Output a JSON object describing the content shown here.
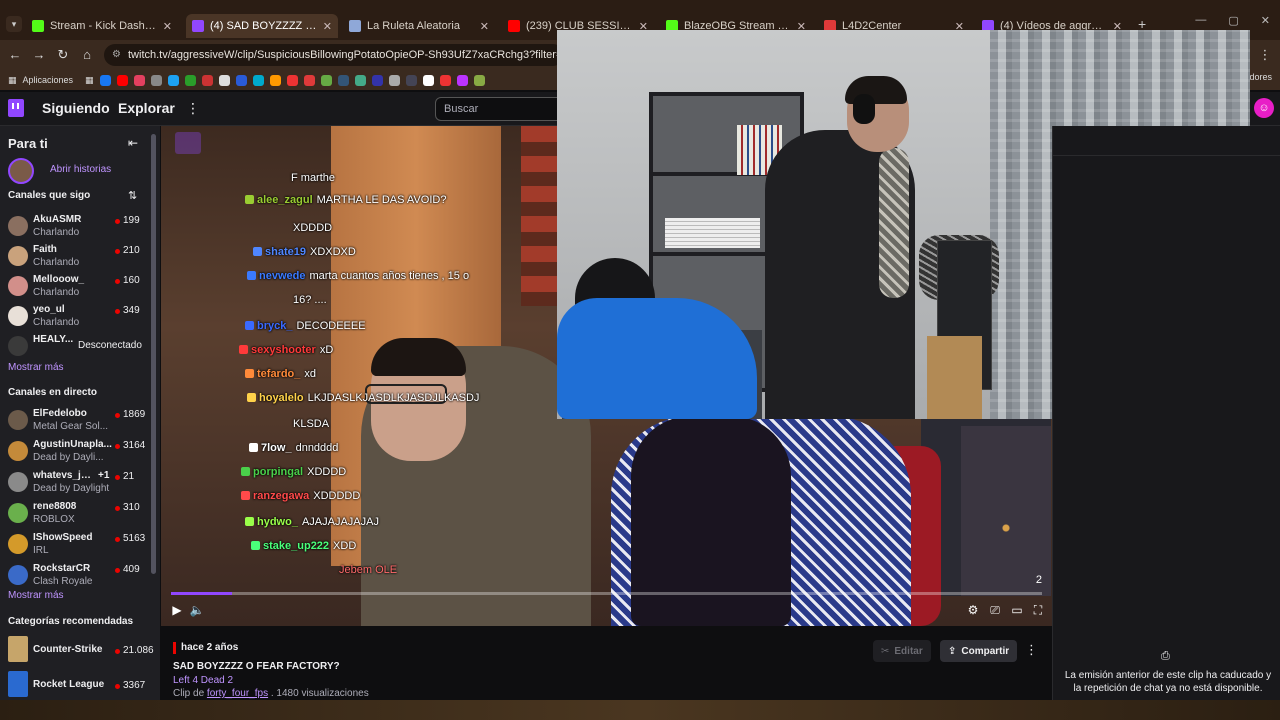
{
  "browser": {
    "tabs": [
      {
        "label": "Stream - Kick Dashboard",
        "color": "#53fc18",
        "active": false
      },
      {
        "label": "(4) SAD BOYZZZZ O FEAR FACTO",
        "color": "#9147ff",
        "active": true
      },
      {
        "label": "La Ruleta Aleatoria",
        "color": "#8fa8d8",
        "active": false
      },
      {
        "label": "(239) CLUB SESSION #01 | DJ S",
        "color": "#ff0000",
        "active": false
      },
      {
        "label": "BlazeOBG Stream - Watch Live",
        "color": "#53fc18",
        "active": false
      },
      {
        "label": "L4D2Center",
        "color": "#e03a3a",
        "active": false
      },
      {
        "label": "(4) Vídeos de aggressiveW - Tw",
        "color": "#9147ff",
        "active": false
      }
    ],
    "url": "twitch.tv/aggressiveW/clip/SuspiciousBillowingPotatoOpieOP-Sh93UfZ7xaCRchg3?filter=clips&range=all",
    "bookmarks_label": "Aplicaciones",
    "bookmarks_right": "adores"
  },
  "twitch_nav": {
    "following": "Siguiendo",
    "browse": "Explorar",
    "search_placeholder": "Buscar"
  },
  "sidebar": {
    "for_you": "Para ti",
    "stories": "Abrir historias",
    "followed_title": "Canales que sigo",
    "followed": [
      {
        "name": "AkuASMR",
        "category": "Charlando",
        "viewers": "199",
        "color": "#8a6f60"
      },
      {
        "name": "Faith",
        "category": "Charlando",
        "viewers": "210",
        "color": "#c9a27c"
      },
      {
        "name": "Mellooow_",
        "category": "Charlando",
        "viewers": "160",
        "color": "#d28f8a"
      },
      {
        "name": "yeo_ul",
        "category": "Charlando",
        "viewers": "349",
        "color": "#e8e0d8"
      }
    ],
    "offline": {
      "name": "HEALY...",
      "status": "Desconectado",
      "color": "#3a3a3a"
    },
    "show_more": "Mostrar más",
    "live_title": "Canales en directo",
    "live": [
      {
        "name": "ElFedelobo",
        "category": "Metal Gear Sol...",
        "viewers": "1869",
        "color": "#6b5a4a"
      },
      {
        "name": "AgustinUnapla...",
        "category": "Dead by Dayli...",
        "viewers": "3164",
        "color": "#c48a3a"
      },
      {
        "name": "whatevs_jan...",
        "extra": "+1",
        "category": "Dead by Daylight",
        "viewers": "21",
        "color": "#8a8a8a"
      },
      {
        "name": "rene8808",
        "category": "ROBLOX",
        "viewers": "310",
        "color": "#6ab04c"
      },
      {
        "name": "IShowSpeed",
        "category": "IRL",
        "viewers": "5163",
        "color": "#d49a2a"
      },
      {
        "name": "RockstarCR",
        "category": "Clash Royale",
        "viewers": "409",
        "color": "#3a6ac8"
      }
    ],
    "show_more_2": "Mostrar más",
    "recommended_title": "Categorías recomendadas",
    "recommended": [
      {
        "name": "Counter-Strike",
        "viewers": "21.086",
        "color": "#c6a56a"
      },
      {
        "name": "Rocket League",
        "viewers": "3367",
        "color": "#2a6ad0"
      }
    ]
  },
  "video": {
    "chat": [
      {
        "user": "",
        "text": "F marthe",
        "color": "#ffffff"
      },
      {
        "user": "alee_zagul",
        "text": "MARTHA LE DAS AVOID?",
        "color": "#9acd32"
      },
      {
        "user": "",
        "text": "XDDDD",
        "color": "#ffffff"
      },
      {
        "user": "shate19",
        "text": "XDXDXD",
        "color": "#4f86ff"
      },
      {
        "user": "nevwede",
        "text": "marta cuantos años tienes , 15 o",
        "color": "#3a7aff"
      },
      {
        "user": "",
        "text": "16? ....",
        "color": "#ffffff"
      },
      {
        "user": "bryck_",
        "text": "DECODEEEE",
        "color": "#3a6aff"
      },
      {
        "user": "sexyshooter",
        "text": "xD",
        "color": "#ff3a3a"
      },
      {
        "user": "tefardo_",
        "text": "xd",
        "color": "#ff8a3a"
      },
      {
        "user": "hoyalelo",
        "text": "LKJDASLKJASDLKJASDJLKASDJ",
        "color": "#ffd24a"
      },
      {
        "user": "",
        "text": "KLSDA",
        "color": "#ffffff"
      },
      {
        "user": "7low_",
        "text": "dnndddd",
        "color": "#ffffff"
      },
      {
        "user": "porpingal",
        "text": "XDDDD",
        "color": "#4ad04a"
      },
      {
        "user": "ranzegawa",
        "text": "XDDDDD",
        "color": "#ff4a4a"
      },
      {
        "user": "hydwo_",
        "text": "AJAJAJAJAJAJ",
        "color": "#9aff4a"
      },
      {
        "user": "stake_up222",
        "text": "XDD",
        "color": "#4aff7a"
      },
      {
        "user": "",
        "text": "Jebem OLE",
        "color": "#ff6a6a"
      }
    ],
    "timestamp": "2",
    "progress": 0.07
  },
  "clip": {
    "time_ago": "hace 2 años",
    "title": "SAD BOYZZZZ O FEAR FACTORY?",
    "game": "Left 4 Dead 2",
    "clip_prefix": "Clip de",
    "author": "forty_four_fps",
    "views": " . 1480 visualizaciones",
    "edit_label": "Editar",
    "share_label": "Compartir"
  },
  "chat_panel": {
    "message": "La emisión anterior de este clip ha caducado y la repetición de chat ya no está disponible."
  }
}
